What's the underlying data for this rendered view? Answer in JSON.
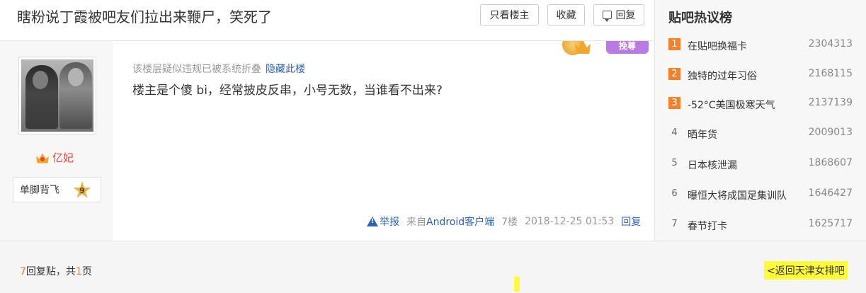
{
  "header": {
    "title": "瞎粉说丁霞被吧友们拉出来鞭尸，笑死了",
    "only_op_label": "只看楼主",
    "favorite_label": "收藏",
    "reply_label": "回复"
  },
  "post": {
    "author_name": "亿妃",
    "level_name": "单脚背飞",
    "level_number": "9",
    "medal_tag": "挽尊",
    "fold_notice": "该楼层疑似违规已被系统折叠",
    "fold_link": "隐藏此楼",
    "content": "楼主是个傻 bi，经常披皮反串，小号无数，当谁看不出来?",
    "meta": {
      "report_label": "举报",
      "client_prefix": "来自",
      "client_name": "Android客户端",
      "floor": "7楼",
      "time": "2018-12-25 01:53",
      "reply_label": "回复"
    }
  },
  "sidebar": {
    "title": "贴吧热议榜",
    "items": [
      {
        "rank": "1",
        "name": "在贴吧换福卡",
        "count": "2304313"
      },
      {
        "rank": "2",
        "name": "独特的过年习俗",
        "count": "2168115"
      },
      {
        "rank": "3",
        "name": "-52°C美国极寒天气",
        "count": "2137139"
      },
      {
        "rank": "4",
        "name": "晒年货",
        "count": "2009013"
      },
      {
        "rank": "5",
        "name": "日本核泄漏",
        "count": "1868607"
      },
      {
        "rank": "6",
        "name": "曝恒大将成国足集训队",
        "count": "1646427"
      },
      {
        "rank": "7",
        "name": "春节打卡",
        "count": "1625717"
      }
    ]
  },
  "footer": {
    "reply_count": "7",
    "reply_text": "回复贴，共",
    "page_count": "1",
    "page_suffix": "页",
    "back_link": "<返回天津女排吧"
  },
  "colors": {
    "link": "#2d64b3",
    "accent": "#f4802a",
    "author": "#e8443a",
    "highlight": "#fffa3a"
  }
}
